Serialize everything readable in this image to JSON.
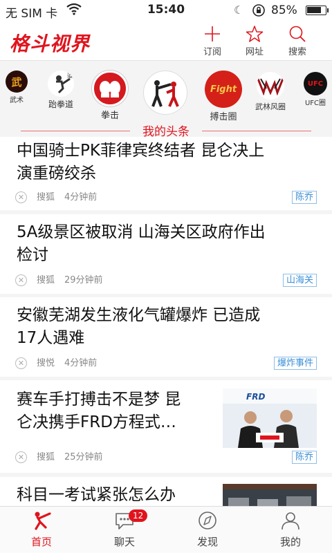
{
  "status": {
    "carrier": "无 SIM 卡",
    "time": "15:40",
    "battery": "85%",
    "battery_level": 0.85
  },
  "header": {
    "logo": "格斗视界",
    "buttons": [
      {
        "label": "订阅",
        "icon": "plus-icon"
      },
      {
        "label": "网址",
        "icon": "star-icon"
      },
      {
        "label": "搜索",
        "icon": "search-icon"
      }
    ]
  },
  "categories": [
    {
      "label": "武术"
    },
    {
      "label": "跆拳道"
    },
    {
      "label": "拳击"
    },
    {
      "label": ""
    },
    {
      "label": "搏击圈",
      "logo_text": "Fight"
    },
    {
      "label": "武林风圈"
    },
    {
      "label": "UFC圈",
      "logo_text": "UFC"
    }
  ],
  "section_title": "我的头条",
  "feed": [
    {
      "headline_1": "中国骑士PK菲律宾终结者 昆仑决上",
      "headline_2": "演重磅绞杀",
      "source": "搜狐",
      "time": "4分钟前",
      "tag": "陈乔"
    },
    {
      "headline_1": "5A级景区被取消 山海关区政府作出",
      "headline_2": "检讨",
      "source": "搜狐",
      "time": "29分钟前",
      "tag": "山海关"
    },
    {
      "headline_1": "安徽芜湖发生液化气罐爆炸 已造成",
      "headline_2": "17人遇难",
      "source": "搜悦",
      "time": "4分钟前",
      "tag": "爆炸事件"
    },
    {
      "headline_1": "赛车手打搏击不是梦 昆",
      "headline_2": "仑决携手FRD方程式…",
      "source": "搜狐",
      "time": "25分钟前",
      "tag": "陈乔",
      "thumb_text": "FRD"
    },
    {
      "headline_1": "科目一考试紧张怎么办",
      "headline_2": ""
    }
  ],
  "tabbar": [
    {
      "label": "首页",
      "icon": "fighter-home-icon"
    },
    {
      "label": "聊天",
      "icon": "chat-bubble-icon",
      "badge": "12"
    },
    {
      "label": "发现",
      "icon": "compass-icon"
    },
    {
      "label": "我的",
      "icon": "user-icon"
    }
  ],
  "colors": {
    "accent": "#e0141d",
    "tag_blue": "#3b8fd6",
    "background": "#f4f4f4"
  }
}
